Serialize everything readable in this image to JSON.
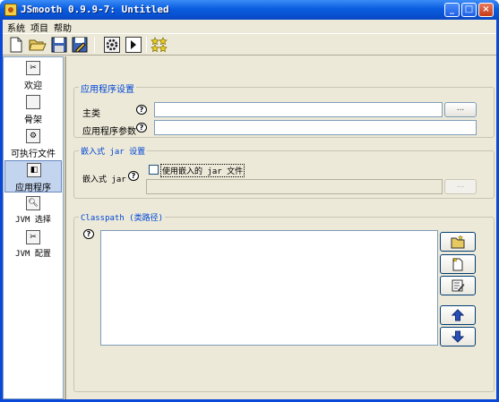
{
  "window": {
    "title": "JSmooth 0.9.9-7: Untitled",
    "controls": {
      "minimize": "_",
      "maximize": "□",
      "close": "×"
    }
  },
  "menu": [
    "系统",
    "项目",
    "帮助"
  ],
  "toolbar": {
    "icons": [
      "new-file-icon",
      "open-folder-icon",
      "save-icon",
      "save-as-icon",
      "compile-gear-icon",
      "run-icon",
      "about-stars-icon"
    ]
  },
  "sidebar": {
    "items": [
      {
        "label": "欢迎",
        "icon": "welcome-icon"
      },
      {
        "label": "骨架",
        "icon": "skeleton-icon"
      },
      {
        "label": "可执行文件",
        "icon": "executable-icon"
      },
      {
        "label": "应用程序",
        "icon": "application-icon",
        "selected": true
      },
      {
        "label": "JVM 选择",
        "icon": "jvm-select-icon"
      },
      {
        "label": "JVM 配置",
        "icon": "jvm-config-icon"
      }
    ]
  },
  "app_settings": {
    "title": "应用程序设置",
    "main_class_label": "主类",
    "main_class_value": "",
    "browse_label": "...",
    "args_label": "应用程序参数",
    "args_value": ""
  },
  "embedded_jar": {
    "title": "嵌入式 jar 设置",
    "label": "嵌入式 jar",
    "checkbox_label": "使用嵌入的 jar 文件",
    "checked": false,
    "path_value": "",
    "browse_label": "..."
  },
  "classpath": {
    "title": "Classpath (类路径)",
    "entries": [],
    "buttons": [
      "add-folder-icon",
      "add-file-icon",
      "edit-icon",
      "move-up-icon",
      "move-down-icon"
    ]
  },
  "help_symbol": "?"
}
